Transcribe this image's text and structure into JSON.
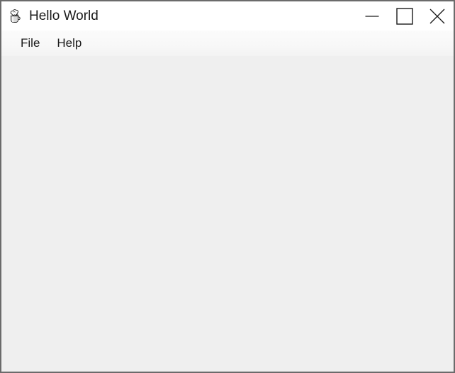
{
  "window": {
    "title": "Hello World",
    "icon": "java-coffee-cup-icon",
    "frame_border_color": "#6b6b6b",
    "titlebar_background": "#ffffff",
    "menubar_background": "#f7f7f7",
    "content_background": "#efefef",
    "text_color": "#1a1a1a"
  },
  "controls": {
    "minimize": {
      "label": "Minimize",
      "icon": "minimize-icon",
      "glyph": "—"
    },
    "maximize": {
      "label": "Maximize",
      "icon": "maximize-icon",
      "glyph": "□"
    },
    "close": {
      "label": "Close",
      "icon": "close-icon",
      "glyph": "✕"
    }
  },
  "menubar": {
    "items": [
      {
        "label": "File",
        "name": "menu-item-file"
      },
      {
        "label": "Help",
        "name": "menu-item-help"
      }
    ]
  },
  "content": {
    "body_text": ""
  }
}
